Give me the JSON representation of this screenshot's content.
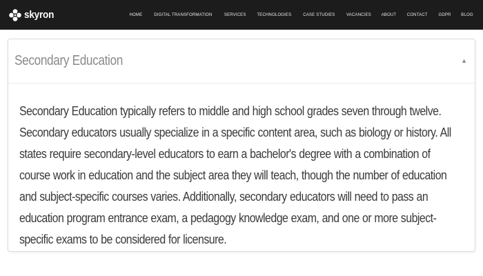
{
  "header": {
    "brand_name": "skyron",
    "brand_logo_icon": "flower-logo-icon",
    "nav_items": [
      {
        "label": "HOME"
      },
      {
        "label": "DIGITAL TRANSFORMATION"
      },
      {
        "label": "SERVICES"
      },
      {
        "label": "TECHNOLOGIES"
      },
      {
        "label": "CASE STUDIES"
      },
      {
        "label": "VACANCIES"
      },
      {
        "label": "ABOUT"
      },
      {
        "label": "CONTACT"
      },
      {
        "label": "GDPR"
      },
      {
        "label": "BLOG"
      }
    ]
  },
  "accordion": {
    "title": "Secondary Education",
    "toggle_icon": "caret-up-icon",
    "expanded": true,
    "body": "Secondary Education typically refers to middle and high school grades seven through twelve. Secondary educators usually specialize in a specific content area, such as biology or history. All states require secondary-level educators to earn a bachelor's degree with a combination of course work in education and the subject area they will teach, though the number of education and subject-specific courses varies. Additionally, secondary educators will need to pass an education program entrance exam, a pedagogy knowledge exam, and one or more subject-specific exams to be considered for licensure."
  },
  "colors": {
    "navbar_bg": "#1c1c1c",
    "nav_text": "#e8e8e8",
    "panel_border": "#dcdcdc",
    "title_text": "#8a8a8a",
    "body_text": "#3a3a3a"
  }
}
